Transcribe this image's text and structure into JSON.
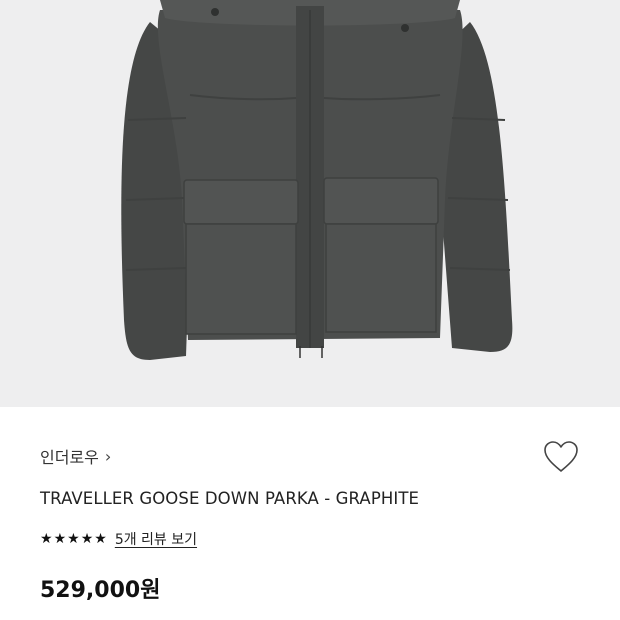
{
  "product": {
    "brand_label": "인더로우",
    "brand_chevron": "›",
    "title": "TRAVELLER GOOSE DOWN PARKA - GRAPHITE",
    "rating_stars": 5,
    "review_link": "5개 리뷰 보기",
    "price": "529,000원",
    "image_icon": "parka-photo",
    "wishlist_icon": "heart-outline-icon"
  },
  "colors": {
    "image_background": "#eeeeef",
    "jacket": "#4b4d4c",
    "text": "#222222"
  }
}
